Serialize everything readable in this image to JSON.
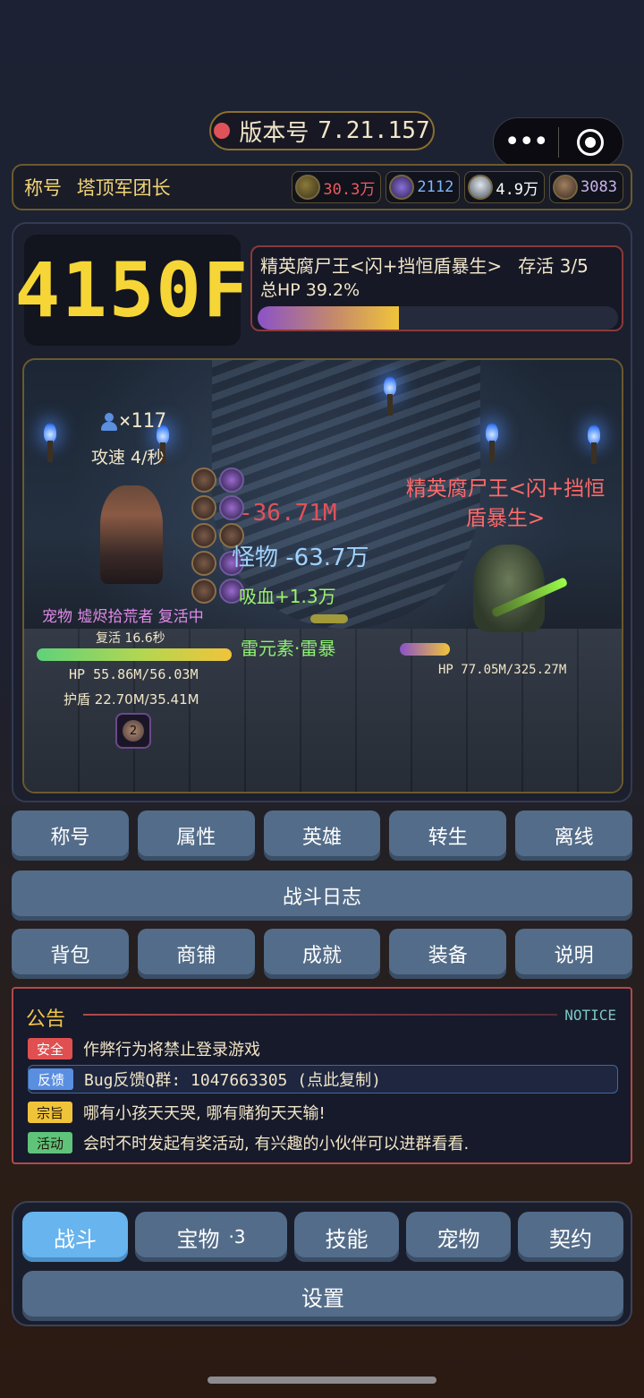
{
  "version": {
    "label": "版本号",
    "value": "7.21.157"
  },
  "title_bar": {
    "title_label": "称号",
    "title_value": "塔顶军团长",
    "resources": [
      {
        "icon": "gold-coin-icon",
        "value": "30.3万",
        "color": "#f05a5a"
      },
      {
        "icon": "vortex-icon",
        "value": "2112",
        "color": "#7fb6ff"
      },
      {
        "icon": "water-drop-icon",
        "value": "4.9万",
        "color": "#ffffff"
      },
      {
        "icon": "stone-icon",
        "value": "3083",
        "color": "#c8b4e8"
      }
    ]
  },
  "floor": "4150F",
  "boss_info": {
    "name": "精英腐尸王<闪+挡恒盾暴生>",
    "alive": "存活 3/5",
    "total_hp_label": "总HP 39.2%",
    "total_hp_percent": 39.2
  },
  "battle": {
    "hero_count": "×117",
    "attack_speed": "攻速 4/秒",
    "damage_main": "-36.71M",
    "damage_monster": "怪物 -63.7万",
    "lifesteal": "吸血+1.3万",
    "element": "雷元素·雷暴",
    "boss_name": "精英腐尸王<闪+挡恒盾暴生>",
    "boss_hp": "HP 77.05M/325.27M",
    "boss_hp_fraction": 0.237,
    "pet": "宠物 墟烬拾荒者 复活中",
    "revive": "复活 16.6秒",
    "hero_hp": "HP 55.86M/56.03M",
    "hero_hp_fraction": 0.997,
    "hero_shield": "护盾 22.70M/35.41M",
    "buff_stack": "2"
  },
  "menu_row1": [
    "称号",
    "属性",
    "英雄",
    "转生",
    "离线"
  ],
  "battle_log": "战斗日志",
  "menu_row2": [
    "背包",
    "商铺",
    "成就",
    "装备",
    "说明"
  ],
  "notice": {
    "title": "公告",
    "title_en": "NOTICE",
    "items": [
      {
        "tag": "安全",
        "tag_color": "#e05050",
        "text": "作弊行为将禁止登录游戏"
      },
      {
        "tag": "反馈",
        "tag_color": "#5a8ee0",
        "text": "Bug反馈Q群: 1047663305 (点此复制)"
      },
      {
        "tag": "宗旨",
        "tag_color": "#f0c43a",
        "text": "哪有小孩天天哭, 哪有赌狗天天输!"
      },
      {
        "tag": "活动",
        "tag_color": "#5fc47a",
        "text": "会时不时发起有奖活动, 有兴趣的小伙伴可以进群看看."
      }
    ]
  },
  "bottom_tabs": [
    {
      "label": "战斗",
      "count": ""
    },
    {
      "label": "宝物",
      "count": "·3"
    },
    {
      "label": "技能",
      "count": ""
    },
    {
      "label": "宠物",
      "count": ""
    },
    {
      "label": "契约",
      "count": ""
    }
  ],
  "settings": "设置"
}
